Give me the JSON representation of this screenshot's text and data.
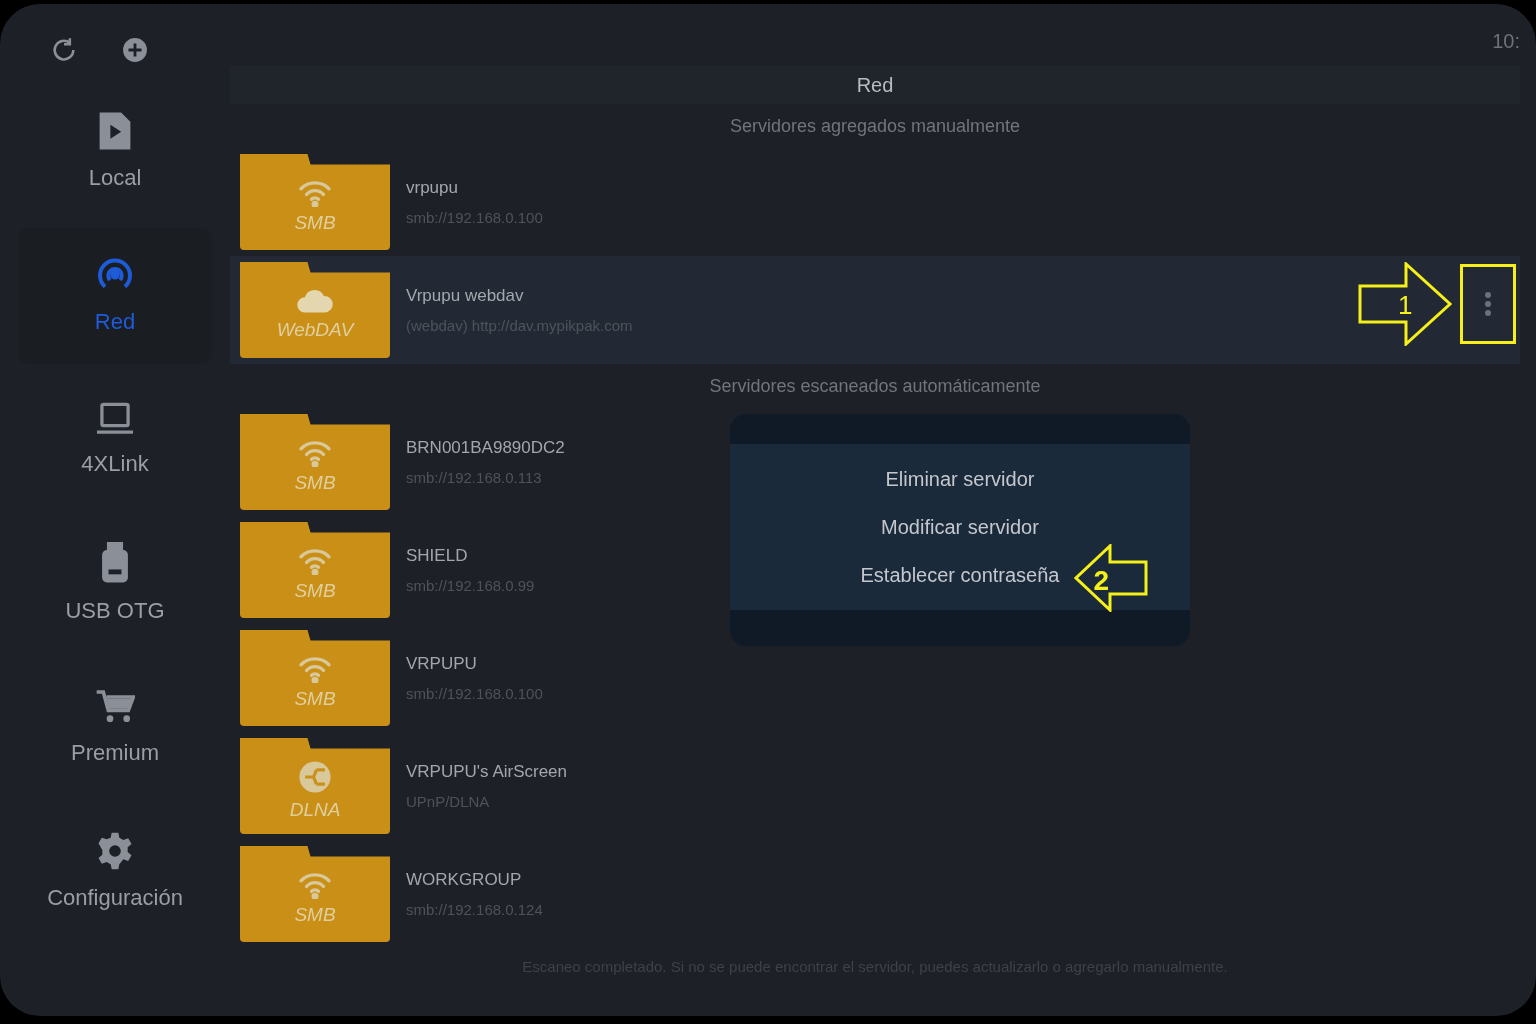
{
  "top_bar": {
    "time": "10:"
  },
  "sidebar": {
    "items": [
      {
        "kind": "play",
        "label": "Local",
        "selected": false
      },
      {
        "kind": "network",
        "label": "Red",
        "selected": true
      },
      {
        "kind": "laptop",
        "label": "4XLink",
        "selected": false
      },
      {
        "kind": "usb",
        "label": "USB OTG",
        "selected": false
      },
      {
        "kind": "cart",
        "label": "Premium",
        "selected": false
      },
      {
        "kind": "gear",
        "label": "Configuración",
        "selected": false
      }
    ]
  },
  "page_title": "Red",
  "sections": [
    {
      "title": "Servidores agregados manualmente",
      "servers": [
        {
          "kind": "smb",
          "badge": "SMB",
          "name": "vrpupu",
          "address": "smb://192.168.0.100",
          "selected": false
        },
        {
          "kind": "webdav",
          "badge": "WebDAV",
          "name": "Vrpupu webdav",
          "address": "(webdav) http://dav.mypikpak.com",
          "selected": true
        }
      ]
    },
    {
      "title": "Servidores escaneados automáticamente",
      "servers": [
        {
          "kind": "smb",
          "badge": "SMB",
          "name": "BRN001BA9890DC2",
          "address": "smb://192.168.0.113",
          "selected": false
        },
        {
          "kind": "smb",
          "badge": "SMB",
          "name": "SHIELD",
          "address": "smb://192.168.0.99",
          "selected": false
        },
        {
          "kind": "smb",
          "badge": "SMB",
          "name": "VRPUPU",
          "address": "smb://192.168.0.100",
          "selected": false
        },
        {
          "kind": "dlna",
          "badge": "DLNA",
          "name": "VRPUPU's AirScreen",
          "address": "UPnP/DLNA",
          "selected": false
        },
        {
          "kind": "smb",
          "badge": "SMB",
          "name": "WORKGROUP",
          "address": "smb://192.168.0.124",
          "selected": false
        }
      ]
    }
  ],
  "status_message": "Escaneo completado. Si no se puede encontrar el servidor, puedes actualizarlo o agregarlo manualmente.",
  "context_menu": {
    "items": [
      "Eliminar servidor",
      "Modificar servidor",
      "Establecer contraseña"
    ]
  },
  "annotations": [
    {
      "label": "1"
    },
    {
      "label": "2"
    }
  ]
}
